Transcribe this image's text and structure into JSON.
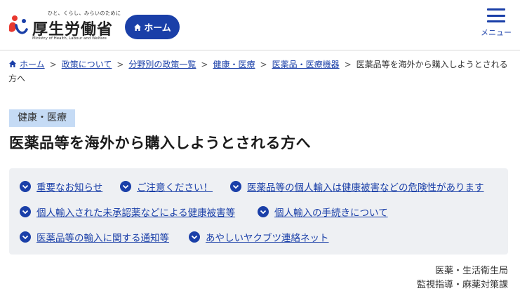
{
  "header": {
    "logo": {
      "tagline": "ひと、くらし、みらいのために",
      "name": "厚生労働省",
      "english": "Ministry of Health, Labour and Welfare"
    },
    "home_button": "ホーム",
    "menu_label": "メニュー"
  },
  "breadcrumb": {
    "items": [
      "ホーム",
      "政策について",
      "分野別の政策一覧",
      "健康・医療",
      "医薬品・医療機器"
    ],
    "current": "医薬品等を海外から購入しようとされる方へ"
  },
  "category": "健康・医療",
  "title": "医薬品等を海外から購入しようとされる方へ",
  "anchors": [
    "重要なお知らせ",
    "ご注意ください！",
    "医薬品等の個人輸入は健康被害などの危険性があります",
    "個人輸入された未承認薬などによる健康被害等",
    "個人輸入の手続きについて",
    "医薬品等の輸入に関する通知等",
    "あやしいヤクブツ連絡ネット"
  ],
  "department": [
    "医薬・生活衛生局",
    "監視指導・麻薬対策課"
  ],
  "colors": {
    "brand": "#1a3fa8",
    "category_bg": "#c5dbf5",
    "anchor_bg": "#eef0f3"
  }
}
